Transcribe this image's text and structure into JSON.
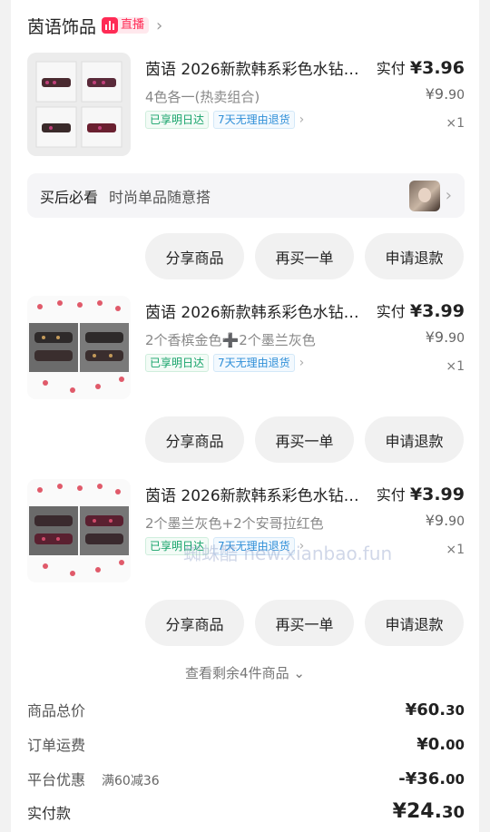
{
  "shop": {
    "name": "茵语饰品",
    "live_label": "直播",
    "live_color": "#ff2b55"
  },
  "items": [
    {
      "title": "茵语 2026新款韩系彩色水钻发夹",
      "spec": "4色各一(热卖组合)",
      "tag1": "已享明日达",
      "tag2": "7天无理由退货",
      "paid_label": "实付",
      "paid_int": "¥3.",
      "paid_dec": "96",
      "orig_int": "¥9.",
      "orig_dec": "90",
      "qty": "×1"
    },
    {
      "title": "茵语 2026新款韩系彩色水钻发夹",
      "spec": "2个香槟金色➕2个墨兰灰色",
      "tag1": "已享明日达",
      "tag2": "7天无理由退货",
      "paid_label": "实付",
      "paid_int": "¥3.",
      "paid_dec": "99",
      "orig_int": "¥9.",
      "orig_dec": "90",
      "qty": "×1"
    },
    {
      "title": "茵语 2026新款韩系彩色水钻发夹",
      "spec": "2个墨兰灰色+2个安哥拉红色",
      "tag1": "已享明日达",
      "tag2": "7天无理由退货",
      "paid_label": "实付",
      "paid_int": "¥3.",
      "paid_dec": "99",
      "orig_int": "¥9.",
      "orig_dec": "90",
      "qty": "×1"
    }
  ],
  "notice": {
    "key": "买后必看",
    "value": "时尚单品随意搭"
  },
  "buttons": {
    "share": "分享商品",
    "rebuy": "再买一单",
    "refund": "申请退款"
  },
  "more": "查看剩余4件商品 ⌄",
  "summary": {
    "total_label": "商品总价",
    "total_int": "¥60.",
    "total_dec": "30",
    "ship_label": "订单运费",
    "ship_int": "¥0.",
    "ship_dec": "00",
    "promo_label": "平台优惠",
    "promo_note": "满60减36",
    "promo_int": "-¥36.",
    "promo_dec": "00",
    "paid_label": "实付款",
    "paid_int": "¥24.",
    "paid_dec": "30"
  },
  "watermark": "蜘蛛酷 new.xianbao.fun"
}
